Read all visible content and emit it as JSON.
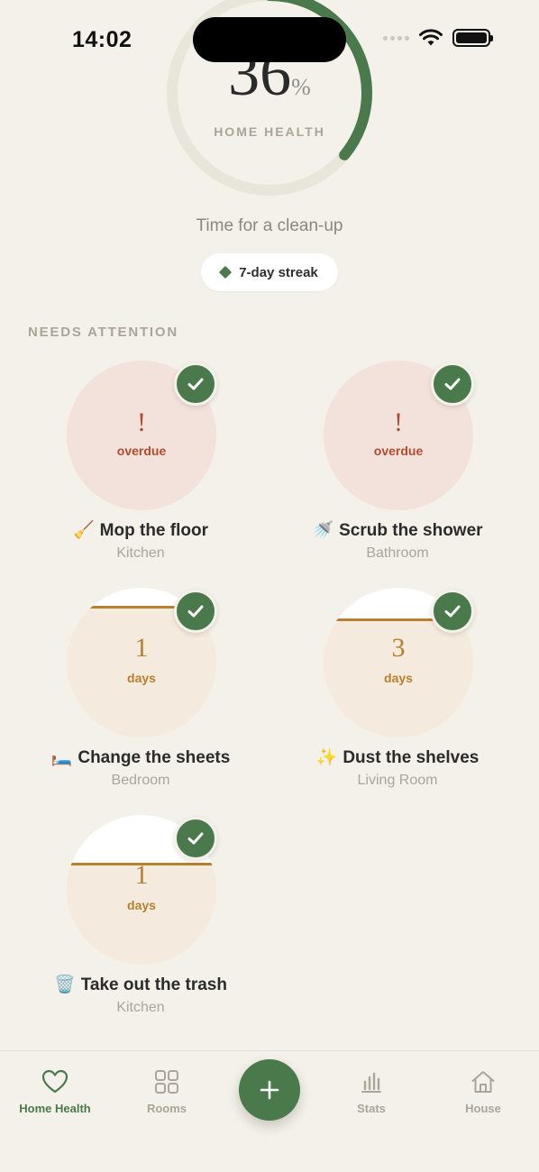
{
  "status_bar": {
    "time": "14:02"
  },
  "home_health": {
    "percent": 36,
    "percent_text": "36",
    "unit": "%",
    "label": "HOME HEALTH",
    "message": "Time for a clean-up",
    "streak": "7-day streak",
    "accent_color": "#4a7a4c"
  },
  "section": {
    "title": "NEEDS ATTENTION"
  },
  "tasks": [
    {
      "emoji": "🧹",
      "title": "Mop the floor",
      "room": "Kitchen",
      "status": "overdue",
      "mark": "!",
      "status_text": "overdue",
      "remaining_fraction": 0
    },
    {
      "emoji": "🚿",
      "title": "Scrub the shower",
      "room": "Bathroom",
      "status": "overdue",
      "mark": "!",
      "status_text": "overdue",
      "remaining_fraction": 0
    },
    {
      "emoji": "🛏️",
      "title": "Change the sheets",
      "room": "Bedroom",
      "status": "pending",
      "number": "1",
      "unit": "days",
      "remaining_fraction": 0.86
    },
    {
      "emoji": "✨",
      "title": "Dust the shelves",
      "room": "Living Room",
      "status": "pending",
      "number": "3",
      "unit": "days",
      "remaining_fraction": 0.78
    },
    {
      "emoji": "🗑️",
      "title": "Take out the trash",
      "room": "Kitchen",
      "status": "pending",
      "number": "1",
      "unit": "days",
      "remaining_fraction": 0.66
    }
  ],
  "tab_bar": {
    "tabs": [
      {
        "label": "Home Health",
        "icon": "heart-icon",
        "active": true
      },
      {
        "label": "Rooms",
        "icon": "grid-icon",
        "active": false
      },
      {
        "label": "Stats",
        "icon": "bar-chart-icon",
        "active": false
      },
      {
        "label": "House",
        "icon": "house-icon",
        "active": false
      }
    ],
    "fab_icon": "plus-icon"
  }
}
